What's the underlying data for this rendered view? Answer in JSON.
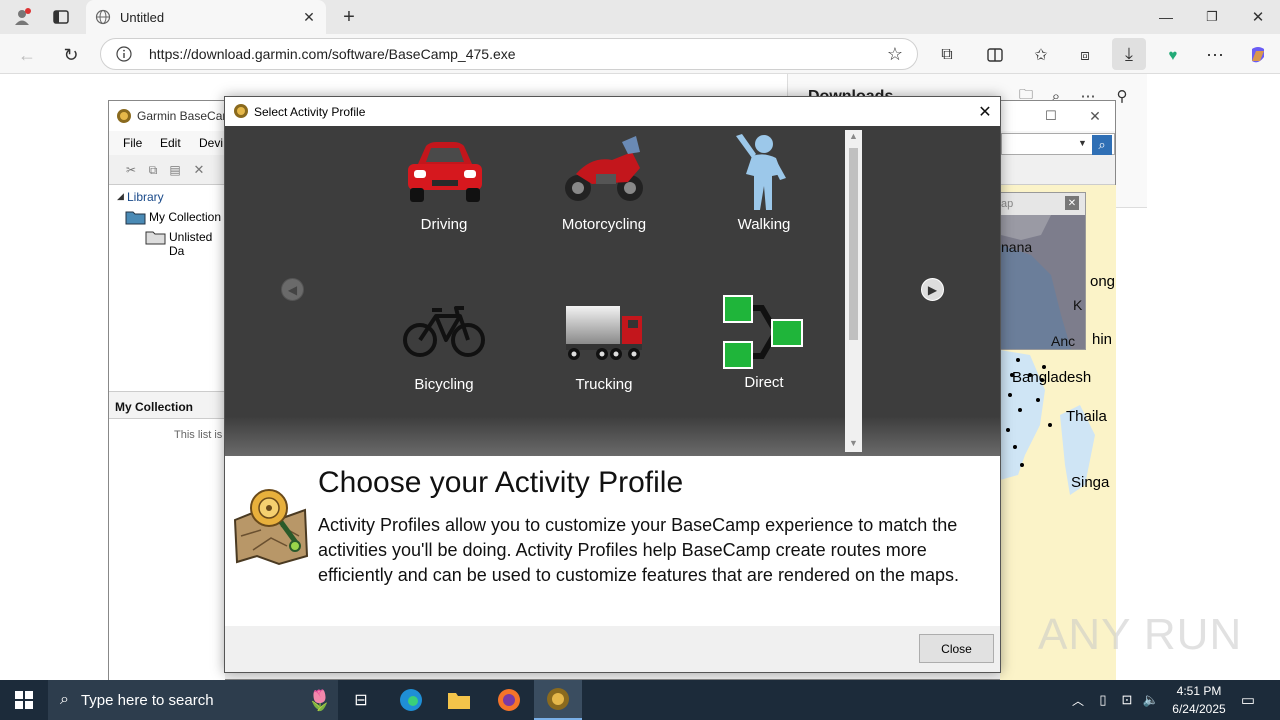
{
  "browser": {
    "tab_title": "Untitled",
    "url": "https://download.garmin.com/software/BaseCamp_475.exe",
    "downloads_title": "Downloads"
  },
  "basecamp": {
    "title": "Garmin BaseCamp",
    "menu": [
      "File",
      "Edit",
      "Devi"
    ],
    "tree": {
      "library": "Library",
      "my_collection": "My Collection",
      "unlisted": "Unlisted Da"
    },
    "collection_header": "My Collection",
    "collection_empty": "This list is e",
    "map_labels": [
      "nana",
      "ong",
      "Bangladesh",
      "Thaila",
      "Singa",
      "Anc",
      "hin",
      "ap",
      "K"
    ]
  },
  "dialog": {
    "title": "Select Activity Profile",
    "profiles": [
      "Driving",
      "Motorcycling",
      "Walking",
      "Bicycling",
      "Trucking",
      "Direct"
    ],
    "heading": "Choose your Activity Profile",
    "body": "Activity Profiles allow you to customize your BaseCamp experience to match the activities you'll be doing. Activity Profiles help BaseCamp create routes more efficiently and can be used to customize features that are rendered on the maps.",
    "close_label": "Close"
  },
  "taskbar": {
    "search_placeholder": "Type here to search",
    "time": "4:51 PM",
    "date": "6/24/2025"
  },
  "watermark": "ANY RUN"
}
